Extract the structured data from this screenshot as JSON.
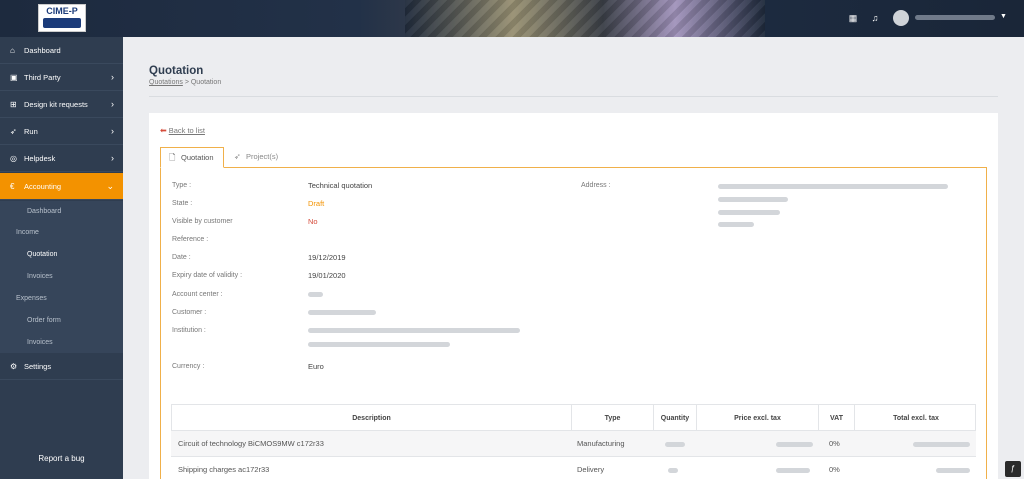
{
  "header": {
    "logo_text": "CIME-P",
    "icons": [
      "calendar-icon",
      "bell-icon",
      "user-avatar",
      "caret-down-icon"
    ]
  },
  "sidebar": {
    "items": [
      {
        "label": "Dashboard",
        "icon": "home-icon"
      },
      {
        "label": "Third Party",
        "icon": "address-book-icon"
      },
      {
        "label": "Design kit requests",
        "icon": "sitemap-icon"
      },
      {
        "label": "Run",
        "icon": "rocket-icon"
      },
      {
        "label": "Helpdesk",
        "icon": "life-ring-icon"
      },
      {
        "label": "Accounting",
        "icon": "euro-icon"
      },
      {
        "label": "Settings",
        "icon": "gears-icon"
      }
    ],
    "accounting_sub": {
      "dashboard": "Dashboard",
      "income": "Income",
      "quotation": "Quotation",
      "invoices_income": "Invoices",
      "expenses": "Expenses",
      "order_form": "Order form",
      "invoices_expenses": "Invoices"
    },
    "report_bug": "Report a bug"
  },
  "page": {
    "title": "Quotation",
    "breadcrumb": {
      "link": "Quotations",
      "separator": ">",
      "current": "Quotation"
    },
    "back_link": "Back to list",
    "tabs": [
      "Quotation",
      "Project(s)"
    ]
  },
  "details": {
    "type_label": "Type :",
    "type_value": "Technical quotation",
    "state_label": "State :",
    "state_value": "Draft",
    "visible_label": "Visible by customer",
    "visible_value": "No",
    "reference_label": "Reference :",
    "date_label": "Date :",
    "date_value": "19/12/2019",
    "expiry_label": "Expiry date of validity :",
    "expiry_value": "19/01/2020",
    "account_center_label": "Account center :",
    "customer_label": "Customer :",
    "institution_label": "Institution :",
    "currency_label": "Currency :",
    "currency_value": "Euro",
    "address_label": "Address :"
  },
  "table": {
    "headers": [
      "Description",
      "Type",
      "Quantity",
      "Price excl. tax",
      "VAT",
      "Total excl. tax"
    ],
    "rows": [
      {
        "description": "Circuit of technology BiCMOS9MW c172r33",
        "type": "Manufacturing",
        "vat": "0%"
      },
      {
        "description": "Shipping charges ac172r33",
        "type": "Delivery",
        "vat": "0%"
      }
    ]
  },
  "colors": {
    "accent": "#f39200",
    "sidebar": "#2f3d50",
    "draft": "#f39200",
    "no": "#d54b3a"
  }
}
